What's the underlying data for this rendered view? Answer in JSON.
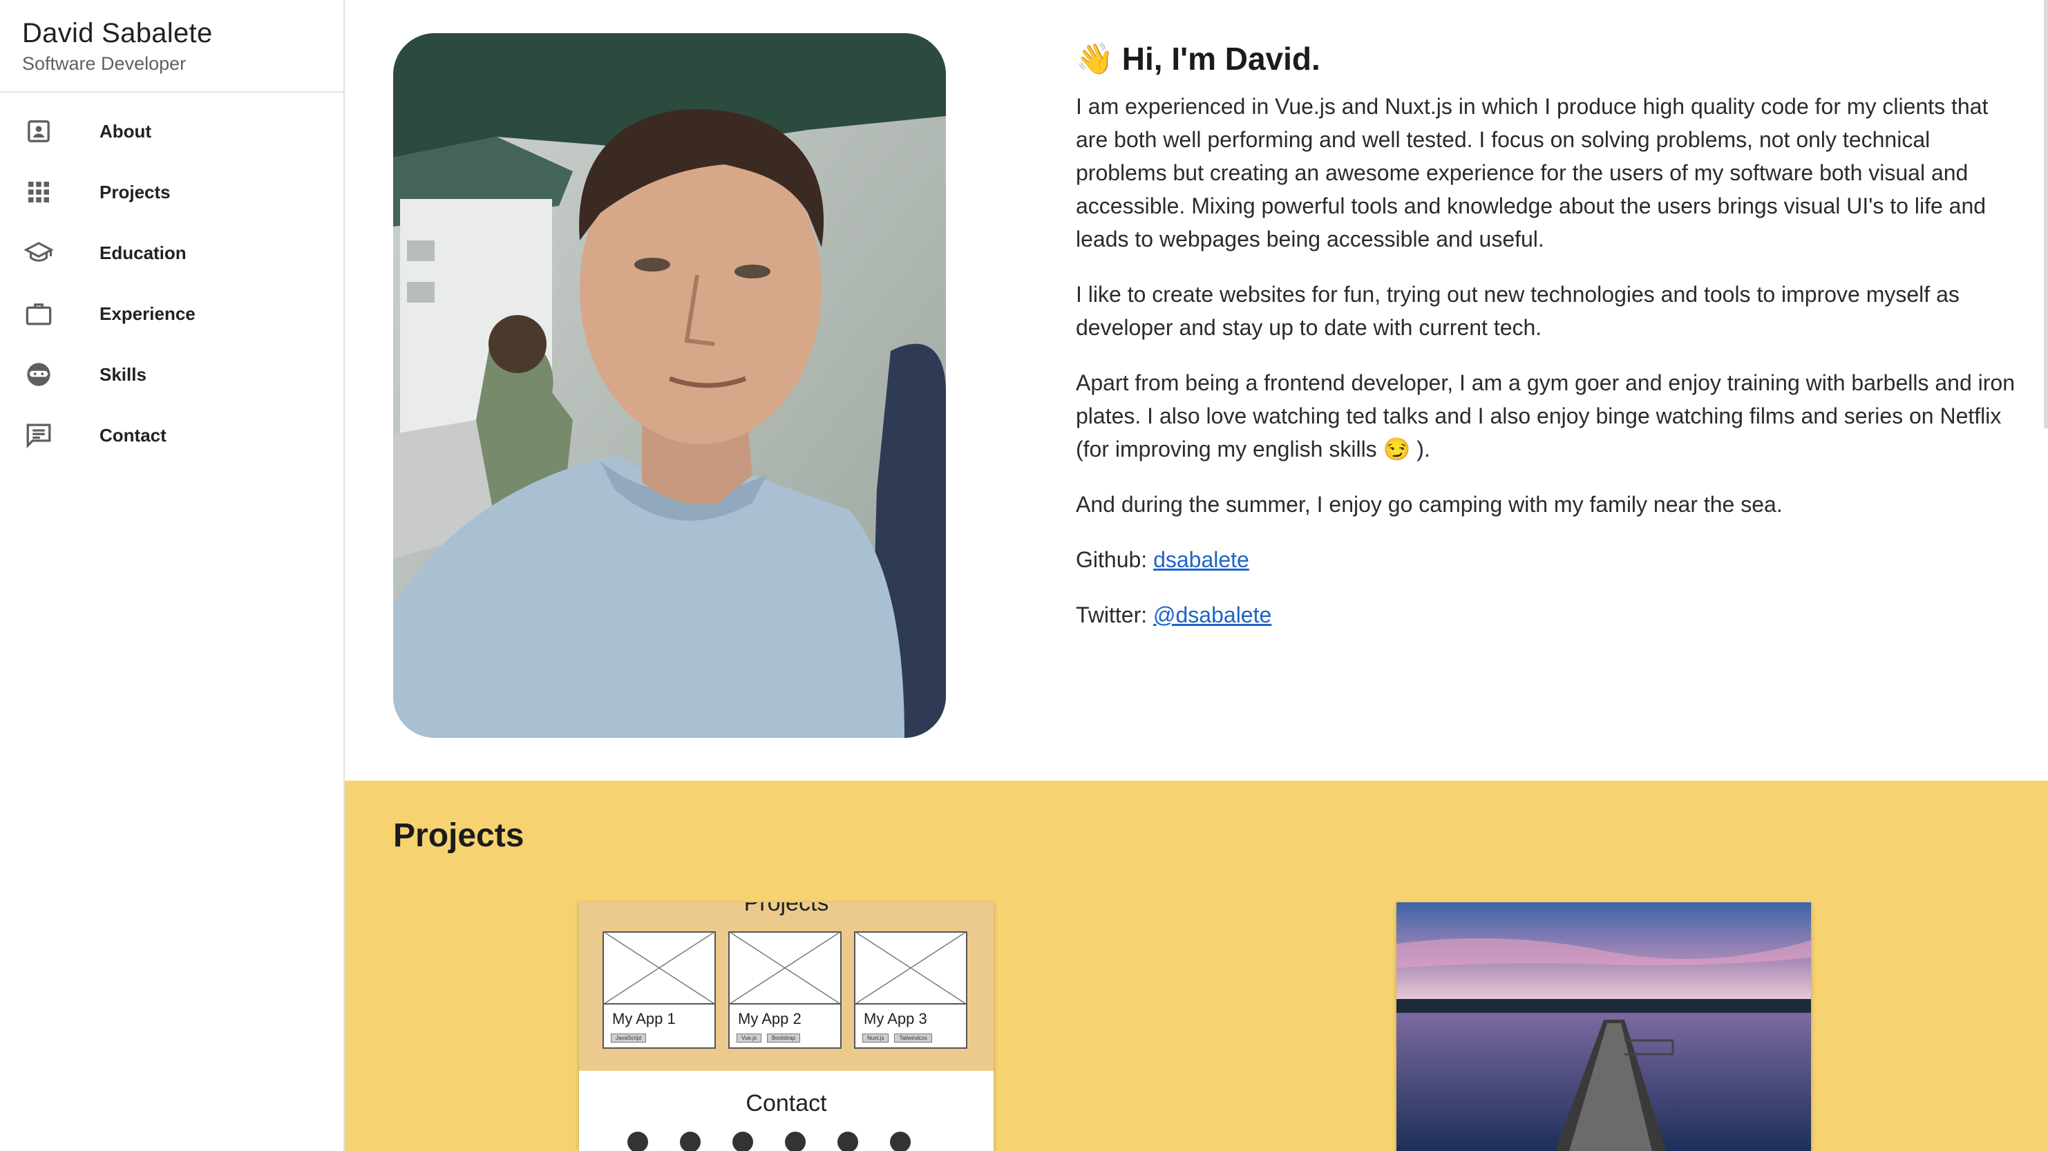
{
  "sidebar": {
    "name": "David Sabalete",
    "role": "Software Developer",
    "items": [
      {
        "label": "About",
        "icon": "account-box-icon"
      },
      {
        "label": "Projects",
        "icon": "apps-grid-icon"
      },
      {
        "label": "Education",
        "icon": "school-icon"
      },
      {
        "label": "Experience",
        "icon": "briefcase-icon"
      },
      {
        "label": "Skills",
        "icon": "ninja-icon"
      },
      {
        "label": "Contact",
        "icon": "message-icon"
      }
    ]
  },
  "about": {
    "greeting_emoji": "👋",
    "greeting": "Hi, I'm David.",
    "p1": "I am experienced in Vue.js and Nuxt.js in which I produce high quality code for my clients that are both well performing and well tested. I focus on solving problems, not only technical problems but creating an awesome experience for the users of my software both visual and accessible. Mixing powerful tools and knowledge about the users brings visual UI's to life and leads to webpages being accessible and useful.",
    "p2": "I like to create websites for fun, trying out new technologies and tools to improve myself as developer and stay up to date with current tech.",
    "p3": "Apart from being a frontend developer, I am a gym goer and enjoy training with barbells and iron plates. I also love watching ted talks and I also enjoy binge watching films and series on Netflix (for improving my english skills 😏 ).",
    "p4": "And during the summer, I enjoy go camping with my family near the sea.",
    "github_label": "Github:",
    "github_link": "dsabalete",
    "twitter_label": "Twitter:",
    "twitter_link": "@dsabalete"
  },
  "projects": {
    "title": "Projects",
    "card1": {
      "heading": "Projects",
      "apps": [
        {
          "title": "My App 1",
          "tags": [
            "JavaScript"
          ]
        },
        {
          "title": "My App 2",
          "tags": [
            "Vue.js",
            "Bootstrap"
          ]
        },
        {
          "title": "My App 3",
          "tags": [
            "Nuxt.js",
            "Tailwindcss"
          ]
        }
      ],
      "contact": "Contact"
    }
  },
  "colors": {
    "projects_bg": "#f6d370",
    "link": "#1e63c8"
  }
}
